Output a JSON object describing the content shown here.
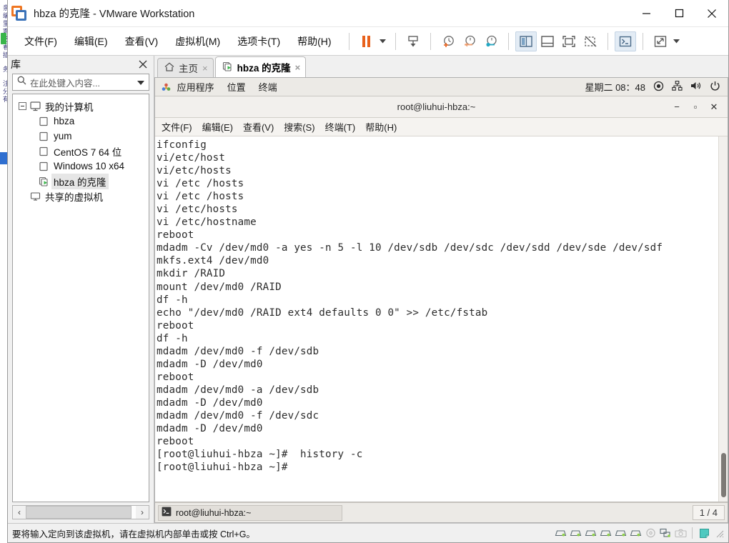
{
  "window": {
    "title": "hbza 的克隆 - VMware Workstation",
    "app_icon": "vmware-icon",
    "minimize_label": "最小化",
    "maximize_label": "最大化",
    "close_label": "关闭"
  },
  "menubar": {
    "items": [
      {
        "label": "文件(F)",
        "name": "menu-file"
      },
      {
        "label": "编辑(E)",
        "name": "menu-edit"
      },
      {
        "label": "查看(V)",
        "name": "menu-view"
      },
      {
        "label": "虚拟机(M)",
        "name": "menu-vm"
      },
      {
        "label": "选项卡(T)",
        "name": "menu-tabs"
      },
      {
        "label": "帮助(H)",
        "name": "menu-help"
      }
    ]
  },
  "toolbar": {
    "pause": "pause-icon",
    "pause_caret": "chevron-down-icon",
    "snapshot": "snapshot-icon",
    "snapshot_take": "take-snapshot-icon",
    "snapshot_revert": "revert-snapshot-icon",
    "snapshot_manager": "snapshot-manager-icon",
    "show_library": "show-library-icon",
    "show_thumbnails": "show-thumbnails-icon",
    "fullscreen": "fullscreen-icon",
    "unity": "unity-mode-icon",
    "console": "console-view-icon",
    "stretch": "stretch-icon",
    "stretch_caret": "chevron-down-icon"
  },
  "sidebar": {
    "title": "库",
    "close": "close-icon",
    "search": {
      "icon": "search-icon",
      "placeholder": "在此处键入内容...",
      "value": "",
      "caret": "chevron-down-icon"
    },
    "tree": [
      {
        "label": "我的计算机",
        "icon": "computer-icon",
        "level": 0,
        "expander": true,
        "selected": false
      },
      {
        "label": "hbza",
        "icon": "vm-icon",
        "level": 1,
        "selected": false
      },
      {
        "label": "yum",
        "icon": "vm-icon",
        "level": 1,
        "selected": false
      },
      {
        "label": "CentOS 7 64 位",
        "icon": "vm-icon",
        "level": 1,
        "selected": false
      },
      {
        "label": "Windows 10 x64",
        "icon": "vm-icon",
        "level": 1,
        "selected": false
      },
      {
        "label": "hbza 的克隆",
        "icon": "vm-running-icon",
        "level": 1,
        "selected": true
      },
      {
        "label": "共享的虚拟机",
        "icon": "shared-vm-icon",
        "level": 0,
        "selected": false
      }
    ],
    "hscroll": {
      "left": "chevron-left-icon",
      "right": "chevron-right-icon"
    }
  },
  "tabs": [
    {
      "label": "主页",
      "icon": "home-icon",
      "active": false,
      "close": "×",
      "name": "tab-home"
    },
    {
      "label": "hbza 的克隆",
      "icon": "vm-running-icon",
      "active": true,
      "close": "×",
      "name": "tab-hbza-clone"
    }
  ],
  "guest": {
    "panel": {
      "applications": "应用程序",
      "places": "位置",
      "terminal": "终端",
      "apps_icon": "applications-icon",
      "clock": "星期二 08：48",
      "tray": [
        {
          "name": "record-indicator-icon"
        },
        {
          "name": "network-icon"
        },
        {
          "name": "volume-icon"
        },
        {
          "name": "power-icon"
        }
      ]
    },
    "terminal": {
      "title": "root@liuhui-hbza:~",
      "minimize": "−",
      "maximize": "▫",
      "close": "✕",
      "menu": [
        "文件(F)",
        "编辑(E)",
        "查看(V)",
        "搜索(S)",
        "终端(T)",
        "帮助(H)"
      ],
      "content": "ifconfig\nvi/etc/host\nvi/etc/hosts\nvi /etc /hosts\nvi /etc /hosts\nvi /etc/hosts\nvi /etc/hostname\nreboot\nmdadm -Cv /dev/md0 -a yes -n 5 -l 10 /dev/sdb /dev/sdc /dev/sdd /dev/sde /dev/sdf\nmkfs.ext4 /dev/md0\nmkdir /RAID\nmount /dev/md0 /RAID\ndf -h\necho \"/dev/md0 /RAID ext4 defaults 0 0\" >> /etc/fstab\nreboot\ndf -h\nmdadm /dev/md0 -f /dev/sdb\nmdadm -D /dev/md0\nreboot\nmdadm /dev/md0 -a /dev/sdb\nmdadm -D /dev/md0\nmdadm /dev/md0 -f /dev/sdc\nmdadm -D /dev/md0\nreboot\n[root@liuhui-hbza ~]#  history -c\n[root@liuhui-hbza ~]#"
    },
    "taskbar": {
      "task_label": "root@liuhui-hbza:~",
      "task_icon": "terminal-icon",
      "workspace": "1 / 4"
    }
  },
  "statusbar": {
    "message": "要将输入定向到该虚拟机，请在虚拟机内部单击或按 Ctrl+G。",
    "devices": [
      {
        "name": "hard-disk-icon"
      },
      {
        "name": "hard-disk-icon"
      },
      {
        "name": "hard-disk-icon"
      },
      {
        "name": "hard-disk-icon"
      },
      {
        "name": "hard-disk-icon"
      },
      {
        "name": "hard-disk-icon"
      },
      {
        "name": "cd-dvd-icon"
      },
      {
        "name": "network-adapter-icon"
      },
      {
        "name": "camera-icon"
      }
    ],
    "notes_icon": "notes-icon",
    "grip": "resize-grip"
  },
  "background_window": {
    "text": "亲编里客签看插  务  注分有"
  },
  "colors": {
    "accent_orange": "#e8611c",
    "accent_blue": "#3b73b9",
    "running_green": "#39b54a",
    "teal": "#2bb3b3"
  }
}
